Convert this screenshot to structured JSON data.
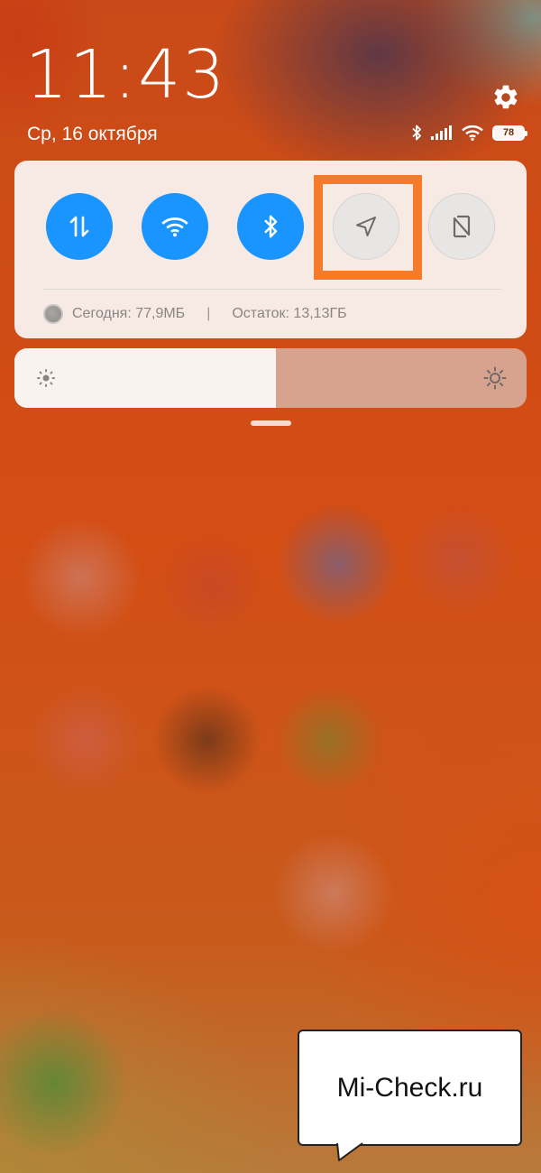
{
  "status": {
    "time": "11:43",
    "date": "Ср, 16 октября",
    "battery_level": "78",
    "icons": [
      "bluetooth-icon",
      "signal-icon",
      "wifi-icon",
      "battery-icon"
    ],
    "settings_icon": "gear-icon"
  },
  "quick_settings": {
    "toggles": [
      {
        "name": "mobile-data",
        "icon": "data-transfer-icon",
        "state": "on"
      },
      {
        "name": "wifi",
        "icon": "wifi-icon",
        "state": "on"
      },
      {
        "name": "bluetooth",
        "icon": "bluetooth-icon",
        "state": "on"
      },
      {
        "name": "location",
        "icon": "location-arrow-icon",
        "state": "off"
      },
      {
        "name": "nfc",
        "icon": "nfc-icon",
        "state": "off"
      }
    ],
    "highlighted_toggle": "location",
    "data_usage": {
      "today": "Сегодня: 77,9МБ",
      "separator": "|",
      "remaining": "Остаток: 13,13ГБ"
    }
  },
  "brightness": {
    "level_fraction": 0.51
  },
  "watermark": {
    "text": "Mi-Check.ru"
  },
  "colors": {
    "accent": "#1a95ff",
    "highlight": "#f57a2a",
    "toggle_off": "#e8e6e4"
  }
}
